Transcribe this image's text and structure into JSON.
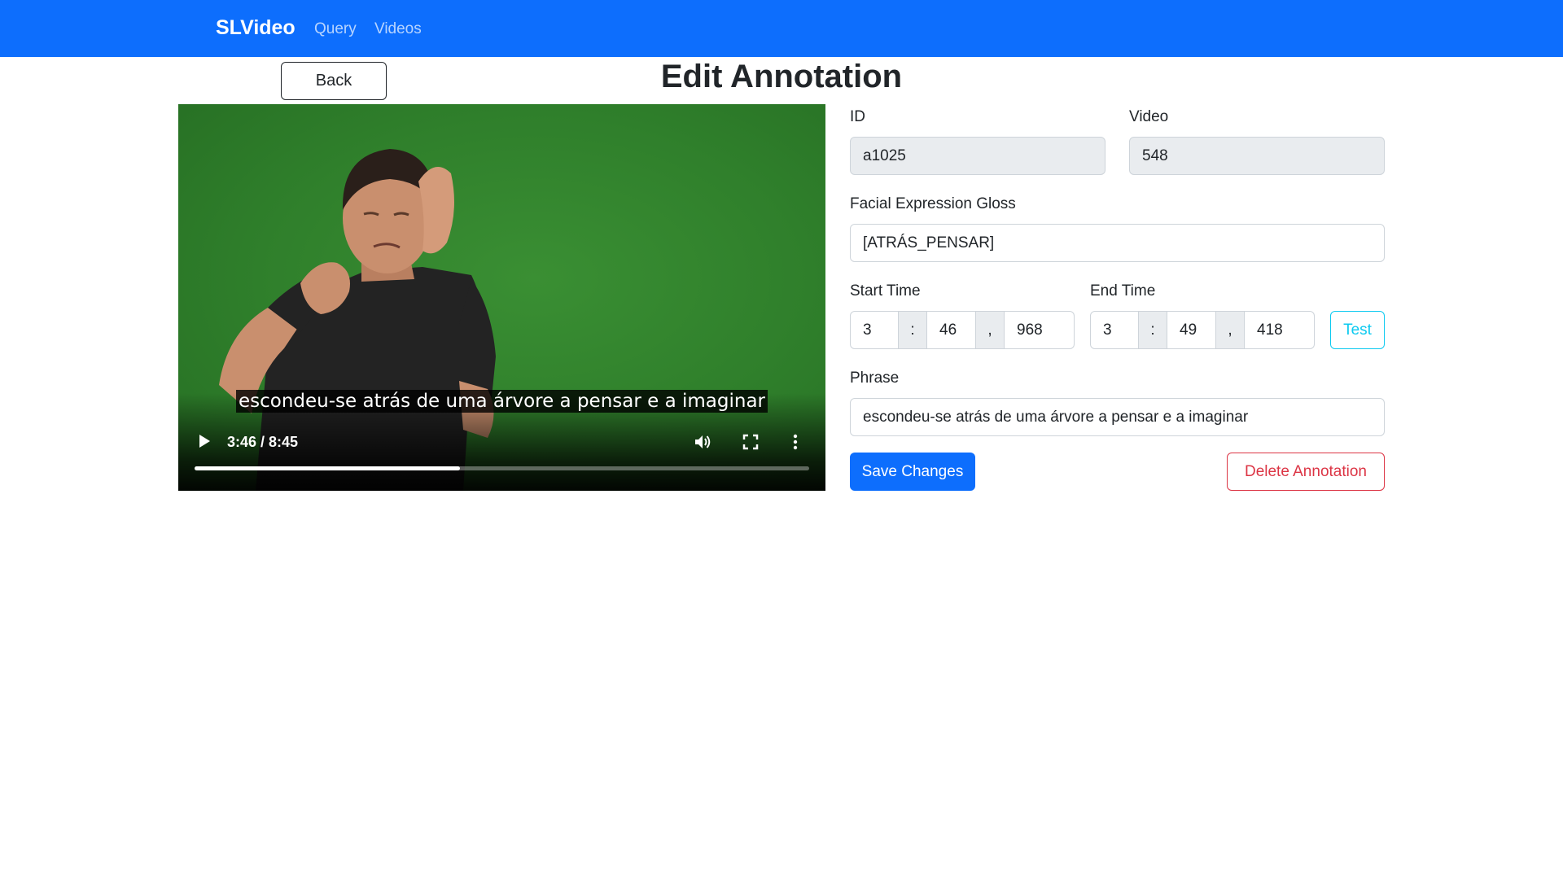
{
  "navbar": {
    "brand": "SLVideo",
    "links": [
      "Query",
      "Videos"
    ],
    "color": "#0d6efd"
  },
  "page": {
    "back_label": "Back",
    "title": "Edit Annotation"
  },
  "player": {
    "subtitle": "escondeu-se atrás de uma árvore a pensar e a imaginar",
    "time_display": "3:46 / 8:45",
    "progress_fraction": 0.432,
    "icons": [
      "play-icon",
      "volume-icon",
      "fullscreen-icon",
      "more-options-icon"
    ]
  },
  "form": {
    "id_label": "ID",
    "id_value": "a1025",
    "video_label": "Video",
    "video_value": "548",
    "gloss_label": "Facial Expression Gloss",
    "gloss_value": "[ATRÁS_PENSAR]",
    "start_label": "Start Time",
    "start": {
      "min": "3",
      "sep1": ":",
      "sec": "46",
      "sep2": ",",
      "ms": "968"
    },
    "end_label": "End Time",
    "end": {
      "min": "3",
      "sep1": ":",
      "sec": "49",
      "sep2": ",",
      "ms": "418"
    },
    "test_label": "Test",
    "phrase_label": "Phrase",
    "phrase_value": "escondeu-se atrás de uma árvore a pensar e a imaginar",
    "save_label": "Save Changes",
    "delete_label": "Delete Annotation"
  },
  "colors": {
    "primary": "#0d6efd",
    "info": "#0dcaf0",
    "danger": "#dc3545",
    "readonly_bg": "#e9ecef"
  }
}
